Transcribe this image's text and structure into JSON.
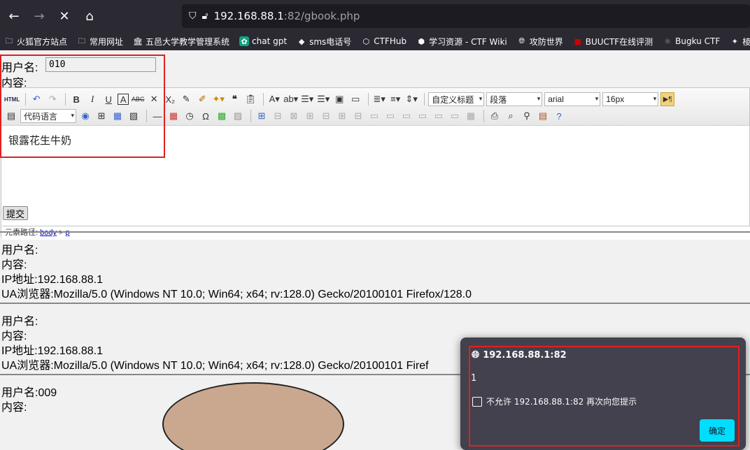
{
  "nav": {
    "back_icon": "arrow-left-icon",
    "forward_icon": "arrow-right-icon",
    "stop_icon": "close-icon",
    "home_icon": "home-icon",
    "url_host": "192.168.88.1",
    "url_rest": ":82/gbook.php"
  },
  "bookmarks": [
    {
      "label": "火狐官方站点",
      "icon": "folder-icon"
    },
    {
      "label": "常用网址",
      "icon": "folder-icon"
    },
    {
      "label": "五邑大学教学管理系统",
      "icon": "building-icon"
    },
    {
      "label": "chat gpt",
      "icon": "openai-icon"
    },
    {
      "label": "sms电话号",
      "icon": "site-icon"
    },
    {
      "label": "CTFHub",
      "icon": "cube-icon"
    },
    {
      "label": "学习资源 - CTF Wiki",
      "icon": "book-icon"
    },
    {
      "label": "攻防世界",
      "icon": "globe-icon"
    },
    {
      "label": "BUUCTF在线评测",
      "icon": "site-icon"
    },
    {
      "label": "Bugku CTF",
      "icon": "site-icon"
    },
    {
      "label": "棱角",
      "icon": "star-icon"
    }
  ],
  "form": {
    "username_label": "用户名:",
    "username_value": "010",
    "content_label": "内容:",
    "editor_text": "银露花生牛奶",
    "path_label": "元素路径: ",
    "path_body": "body",
    "path_sep": " > ",
    "path_p": "p",
    "submit_label": "提交",
    "combo_code": "代码语言",
    "combo_title": "自定义标题",
    "combo_para": "段落",
    "combo_font": "arial",
    "combo_size": "16px",
    "html_label": "HTML"
  },
  "entries": [
    {
      "user": "用户名:",
      "content": "内容:",
      "ip": "IP地址:192.168.88.1",
      "ua": "UA浏览器:Mozilla/5.0 (Windows NT 10.0; Win64; x64; rv:128.0) Gecko/20100101 Firefox/128.0"
    },
    {
      "user": "用户名:",
      "content": "内容:",
      "ip": "IP地址:192.168.88.1",
      "ua": "UA浏览器:Mozilla/5.0 (Windows NT 10.0; Win64; x64; rv:128.0) Gecko/20100101 Firef"
    },
    {
      "user": "用户名:009",
      "content": "内容:"
    }
  ],
  "dialog": {
    "title": "192.168.88.1:82",
    "message": "1",
    "checkbox_label": "不允许 192.168.88.1:82 再次向您提示",
    "ok_label": "确定"
  },
  "colors": {
    "highlight_border": "#e02020",
    "dialog_button": "#00ddff",
    "chrome": "#2b2a33"
  }
}
